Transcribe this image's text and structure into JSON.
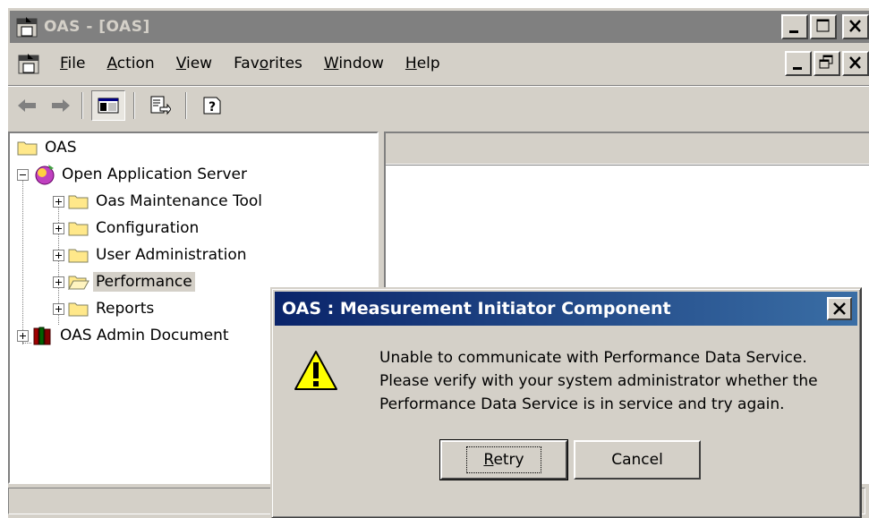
{
  "window": {
    "title": "OAS - [OAS]"
  },
  "menu": {
    "items": [
      {
        "label": "File",
        "accel": "F",
        "rest": "ile"
      },
      {
        "label": "Action",
        "accel": "A",
        "rest": "ction"
      },
      {
        "label": "View",
        "accel": "V",
        "rest": "iew"
      },
      {
        "label": "Favorites",
        "pre": "Fav",
        "accel": "o",
        "rest": "rites"
      },
      {
        "label": "Window",
        "accel": "W",
        "rest": "indow"
      },
      {
        "label": "Help",
        "accel": "H",
        "rest": "elp"
      }
    ]
  },
  "tree": {
    "root": "OAS",
    "server": "Open Application Server",
    "children": [
      "Oas Maintenance Tool",
      "Configuration",
      "User Administration",
      "Performance",
      "Reports"
    ],
    "admin_doc": "OAS Admin Document"
  },
  "dialog": {
    "title": "OAS : Measurement Initiator Component",
    "close_glyph": "✕",
    "message_lines": [
      "Unable to communicate with Performance Data Service.",
      "Please verify with your system administrator whether the",
      "Performance Data Service is in service and try again."
    ],
    "retry_pre": "",
    "retry_accel": "R",
    "retry_rest": "etry",
    "cancel_label": "Cancel"
  },
  "colors": {
    "dialog_title_bg": "#0a246a",
    "face": "#d4d0c8",
    "inactive_title": "#808080"
  }
}
